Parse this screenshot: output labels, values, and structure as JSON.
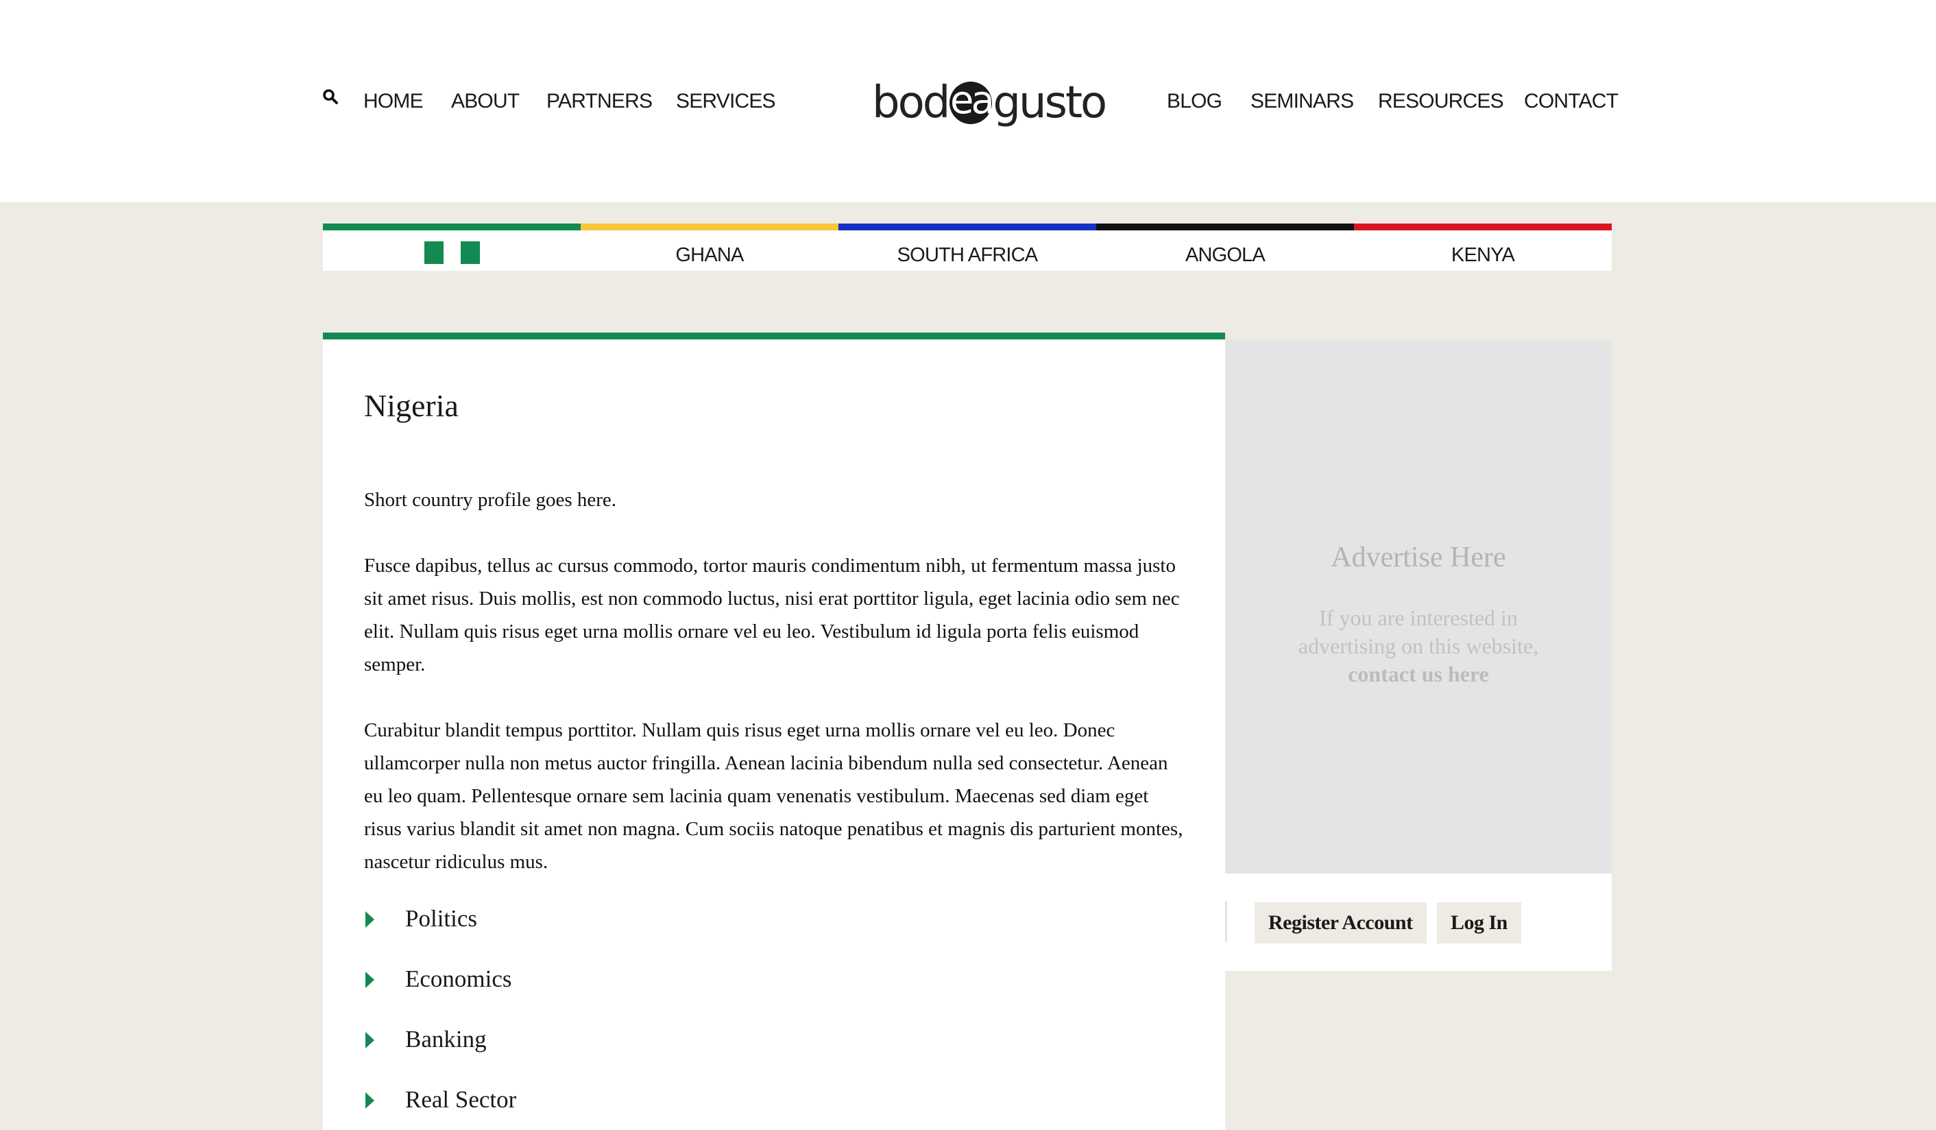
{
  "header": {
    "nav_left": [
      "HOME",
      "ABOUT",
      "PARTNERS",
      "SERVICES"
    ],
    "nav_right": [
      "BLOG",
      "SEMINARS",
      "RESOURCES",
      "CONTACT"
    ],
    "logo": {
      "part1": "bod",
      "part2": "ea",
      "part3": "gusto"
    },
    "icons": {
      "search": "search-icon"
    }
  },
  "country_bar": {
    "tabs": [
      {
        "label": "",
        "color": "#138a52",
        "icon": "nigeria-flag-icon"
      },
      {
        "label": "GHANA",
        "color": "#f6c93a"
      },
      {
        "label": "SOUTH AFRICA",
        "color": "#1531c4"
      },
      {
        "label": "ANGOLA",
        "color": "#111111"
      },
      {
        "label": "KENYA",
        "color": "#d9161f"
      }
    ]
  },
  "main": {
    "title": "Nigeria",
    "paragraphs": [
      "Short country profile goes here.",
      "Fusce dapibus, tellus ac cursus commodo, tortor mauris condimentum nibh, ut fermentum massa justo sit amet risus. Duis mollis, est non commodo luctus, nisi erat porttitor ligula, eget lacinia odio sem nec elit. Nullam quis risus eget urna mollis ornare vel eu leo. Vestibulum id ligula porta felis euismod semper.",
      "Curabitur blandit tempus porttitor. Nullam quis risus eget urna mollis ornare vel eu leo. Donec ullamcorper nulla non metus auctor fringilla. Aenean lacinia bibendum nulla sed consectetur. Aenean eu leo quam. Pellentesque ornare sem lacinia quam venenatis vestibulum. Maecenas sed diam eget risus varius blandit sit amet non magna. Cum sociis natoque penatibus et magnis dis parturient montes, nascetur ridiculus mus."
    ],
    "topics": [
      "Politics",
      "Economics",
      "Banking",
      "Real Sector"
    ]
  },
  "sidebar": {
    "ad_title": "Advertise Here",
    "ad_text_line1": "If you are interested in",
    "ad_text_line2": "advertising on this website,",
    "ad_link": "contact us here",
    "register_label": "Register Account",
    "login_label": "Log In"
  },
  "colors": {
    "accent_green": "#138a52",
    "page_bg": "#eeebe4",
    "ad_bg": "#e4e4e4"
  }
}
